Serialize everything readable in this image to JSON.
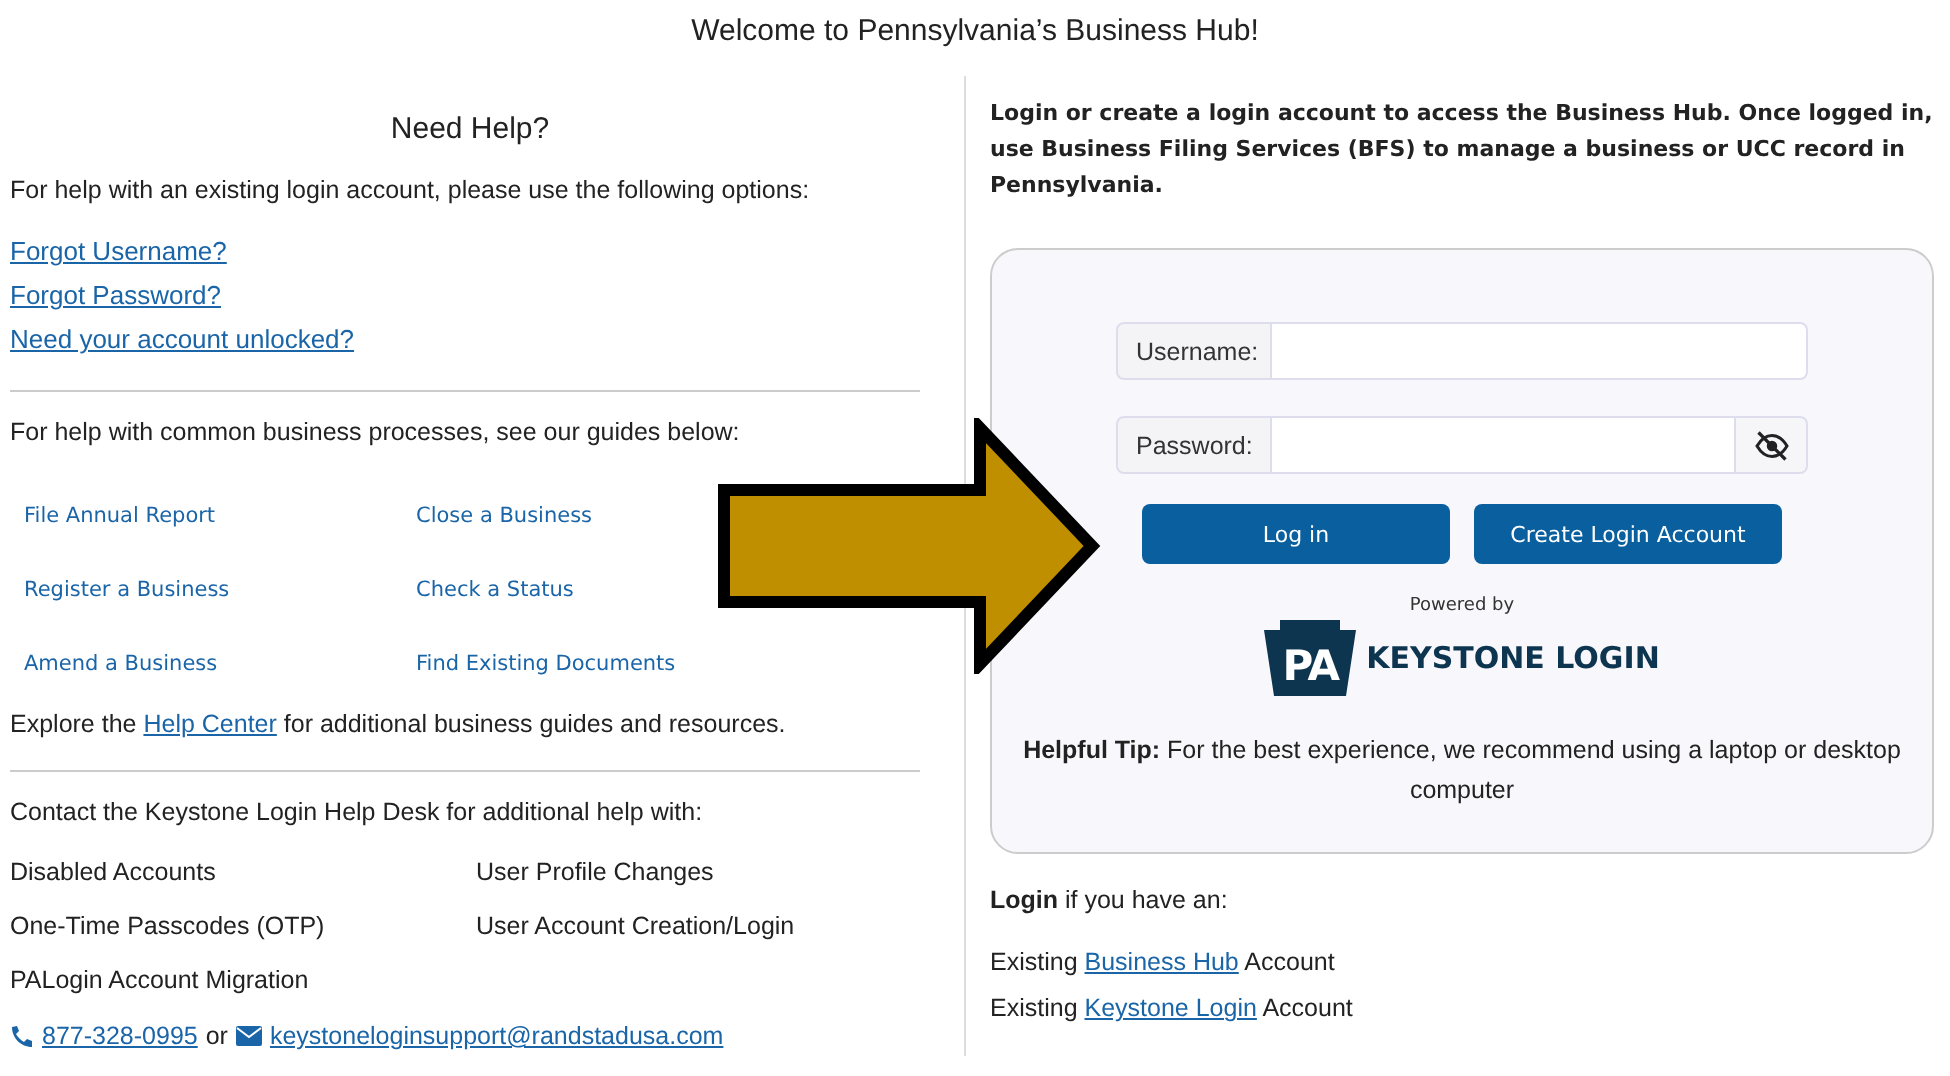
{
  "title": "Welcome to Pennsylvania’s Business Hub!",
  "help": {
    "heading": "Need Help?",
    "intro": "For help with an existing login account, please use the following options:",
    "account_links": [
      "Forgot Username?",
      "Forgot Password?",
      "Need your account unlocked?"
    ],
    "guides_intro": "For help with common business processes, see our guides below:",
    "guides": [
      "File Annual Report",
      "Close a Business",
      "Register a Business",
      "Check a Status",
      "Amend a Business",
      "Find Existing Documents"
    ],
    "explore": {
      "before": "Explore the ",
      "link": "Help Center",
      "after": " for additional business guides and resources."
    },
    "contact_intro": "Contact the Keystone Login Help Desk for additional help with:",
    "topics": [
      "Disabled Accounts",
      "User Profile Changes",
      "One-Time Passcodes (OTP)",
      "User Account Creation/Login",
      "PALogin Account Migration"
    ],
    "phone": "877-328-0995",
    "or": "or",
    "email": "keystoneloginsupport@randstadusa.com"
  },
  "login": {
    "intro": "Login or create a login account to access the Business Hub. Once logged in, use Business Filing Services (BFS) to manage a business or UCC record in Pennsylvania.",
    "username_label": "Username:",
    "password_label": "Password:",
    "buttons": [
      "Log in",
      "Create Login Account"
    ],
    "powered_by": "Powered by",
    "logo_mark": "PA",
    "logo_text": "KEYSTONE LOGIN",
    "tip": "**Helpful Tip:** For the best experience, we recommend using a laptop or desktop computer",
    "login_if": "**Login** if you have an:",
    "accounts": [
      {
        "before": "Existing ",
        "link": "Business Hub",
        "after": " Account"
      },
      {
        "before": "Existing ",
        "link": "Keystone Login",
        "after": " Account"
      }
    ]
  },
  "annotation": {
    "kind": "arrow"
  }
}
